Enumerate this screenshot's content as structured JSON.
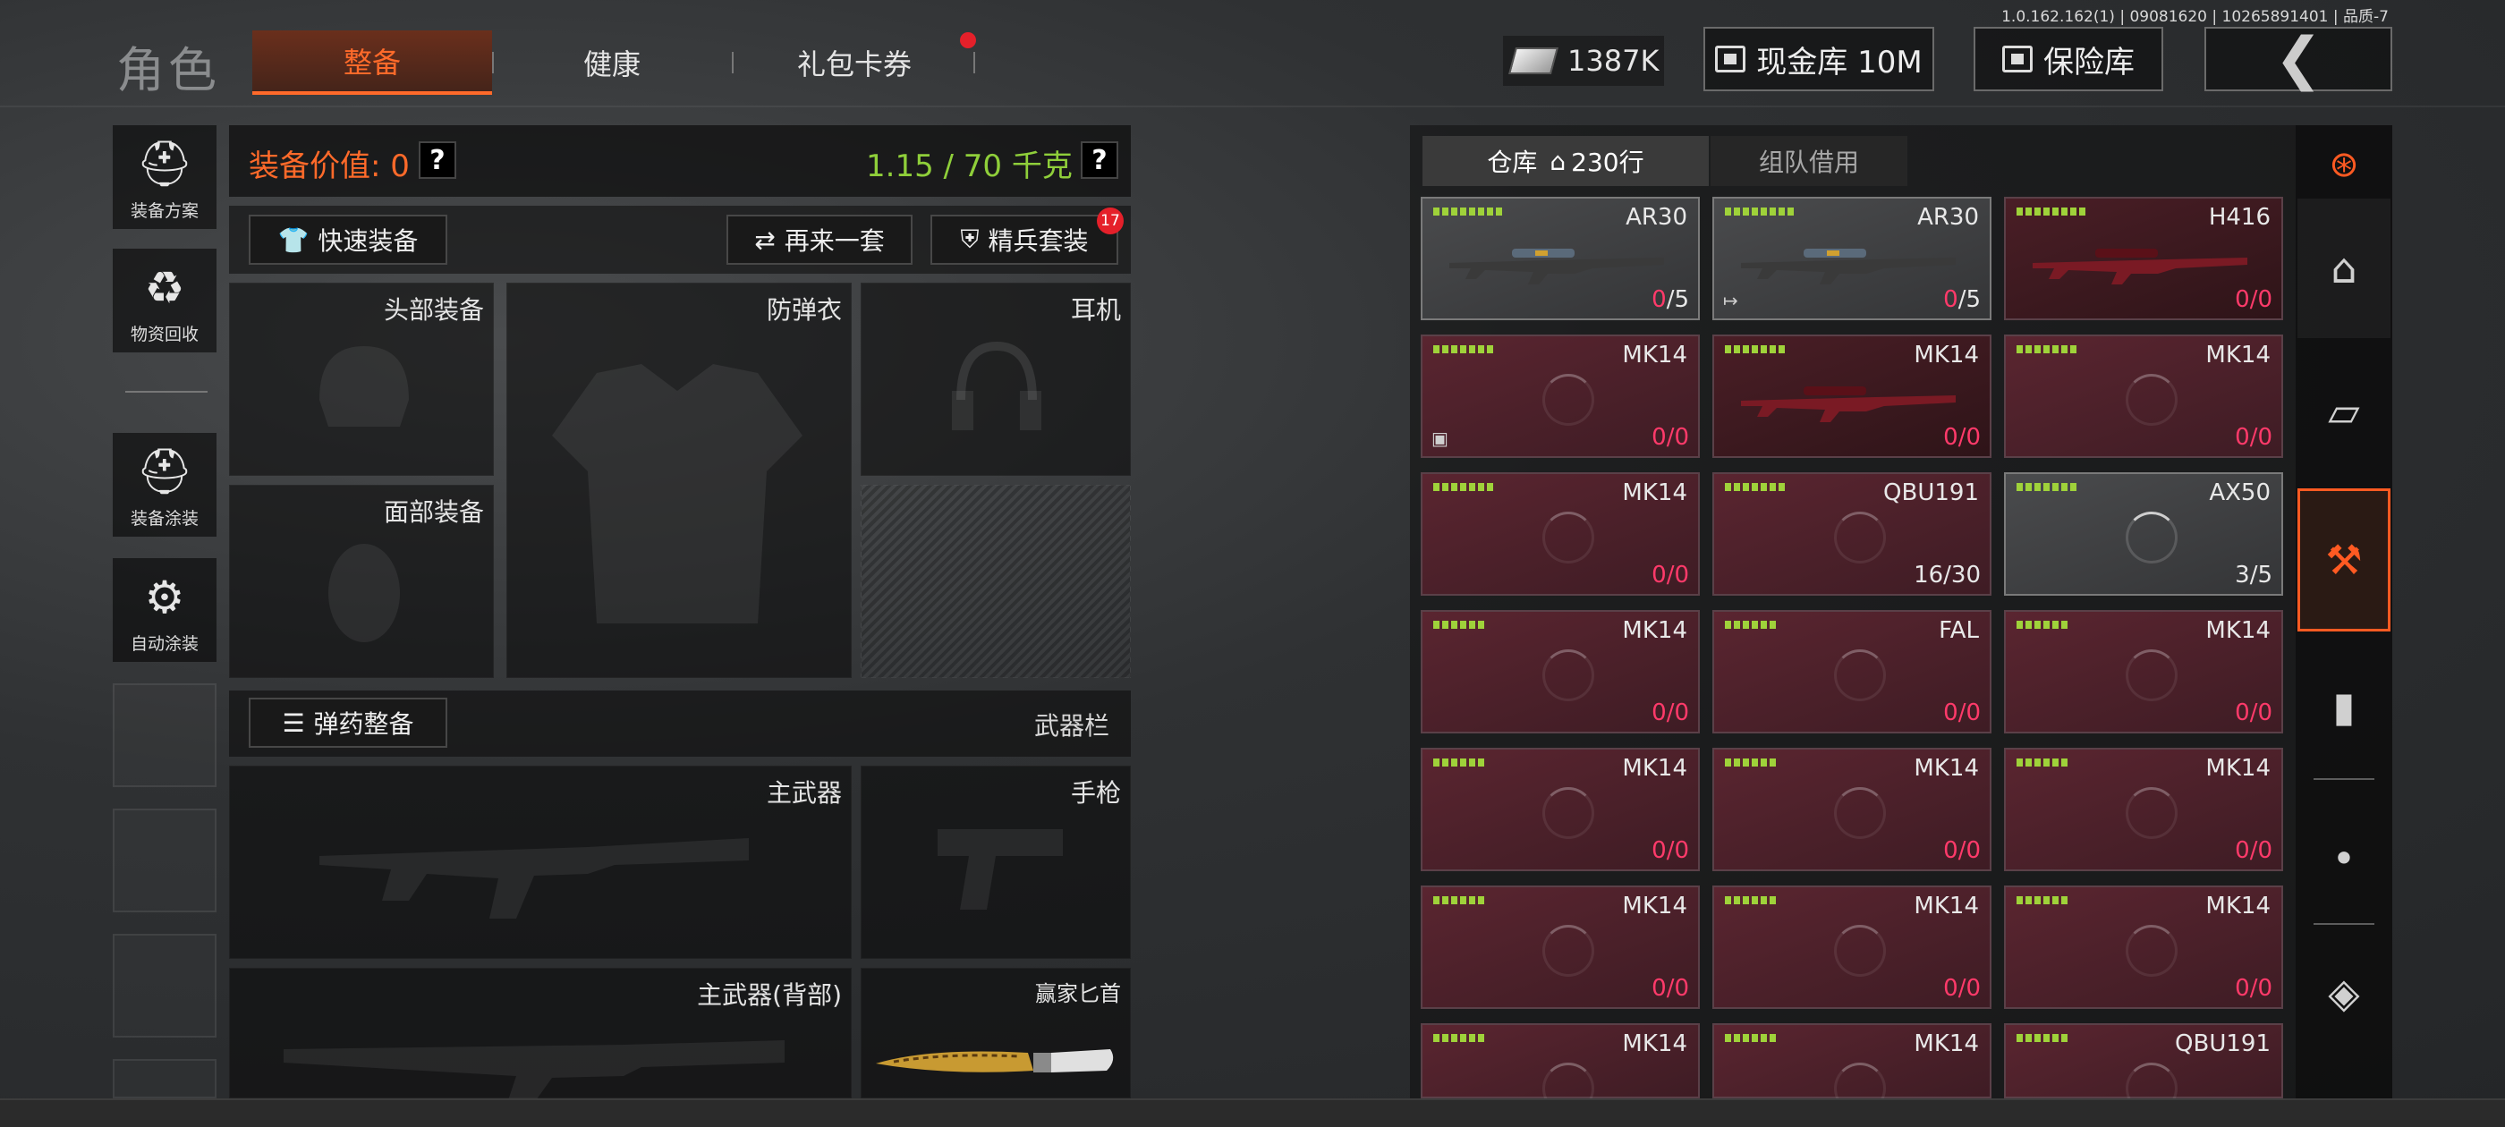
{
  "version": "1.0.162.162(1) | 09081620 | 10265891401 | 品质-7",
  "header": {
    "role_title": "角色",
    "tabs": [
      {
        "label": "整备",
        "active": true
      },
      {
        "label": "健康",
        "active": false
      },
      {
        "label": "礼包卡券",
        "active": false,
        "notification": true
      }
    ],
    "money": "1387K",
    "cash_vault": "现金库 10M",
    "safe": "保险库",
    "back_icon": "chevron-left-icon"
  },
  "side_menu": [
    {
      "label": "装备方案",
      "icon": "helmet-icon"
    },
    {
      "label": "物资回收",
      "icon": "recycle-icon"
    },
    {
      "label": "装备涂装",
      "icon": "paint-helmet-icon"
    },
    {
      "label": "自动涂装",
      "icon": "auto-paint-icon"
    }
  ],
  "equipment": {
    "value_label": "装备价值: 0",
    "weight": "1.15 / 70 千克",
    "help": "?",
    "quick_equip": "快速装备",
    "again_set": "再来一套",
    "elite_set": "精兵套装",
    "elite_badge": "17",
    "slots": {
      "head": "头部装备",
      "face": "面部装备",
      "armor": "防弹衣",
      "headset": "耳机",
      "primary": "主武器",
      "pistol": "手枪",
      "primary_back": "主武器(背部)",
      "knife": "赢家匕首"
    },
    "ammo_button": "弹药整备",
    "weapon_bar": "武器栏"
  },
  "warehouse": {
    "tab_storage": "仓库",
    "tab_rows": "230行",
    "tab_team": "组队借用",
    "colors": {
      "dots": "#9fd23a",
      "zero": "#ff3a6a",
      "accent": "#ff6a2a"
    },
    "items": [
      {
        "name": "AR30",
        "count_a": "0",
        "count_b": "/5",
        "style": "grey",
        "dots": 8,
        "image": "sniper-rifle"
      },
      {
        "name": "AR30",
        "count_a": "0",
        "count_b": "/5",
        "style": "grey",
        "dots": 8,
        "image": "sniper-rifle",
        "corner": "↦"
      },
      {
        "name": "H416",
        "count_a": "0",
        "count_b": "/0",
        "style": "darkred",
        "dots": 8,
        "image": "rifle-red"
      },
      {
        "name": "MK14",
        "count_a": "0",
        "count_b": "/0",
        "style": "red",
        "dots": 7,
        "corner": "▣"
      },
      {
        "name": "MK14",
        "count_a": "0",
        "count_b": "/0",
        "style": "darkred",
        "dots": 7,
        "image": "rifle-red"
      },
      {
        "name": "MK14",
        "count_a": "0",
        "count_b": "/0",
        "style": "red",
        "dots": 7
      },
      {
        "name": "MK14",
        "count_a": "0",
        "count_b": "/0",
        "style": "red",
        "dots": 7
      },
      {
        "name": "QBU191",
        "count_a": "16",
        "count_b": "/30",
        "style": "red",
        "dots": 7,
        "plain": true
      },
      {
        "name": "AX50",
        "count_a": "3",
        "count_b": "/5",
        "style": "grey",
        "dots": 7,
        "plain": true
      },
      {
        "name": "MK14",
        "count_a": "0",
        "count_b": "/0",
        "style": "red",
        "dots": 6
      },
      {
        "name": "FAL",
        "count_a": "0",
        "count_b": "/0",
        "style": "red",
        "dots": 6
      },
      {
        "name": "MK14",
        "count_a": "0",
        "count_b": "/0",
        "style": "red",
        "dots": 6
      },
      {
        "name": "MK14",
        "count_a": "0",
        "count_b": "/0",
        "style": "red",
        "dots": 6
      },
      {
        "name": "MK14",
        "count_a": "0",
        "count_b": "/0",
        "style": "red",
        "dots": 6
      },
      {
        "name": "MK14",
        "count_a": "0",
        "count_b": "/0",
        "style": "red",
        "dots": 6
      },
      {
        "name": "MK14",
        "count_a": "0",
        "count_b": "/0",
        "style": "red",
        "dots": 6
      },
      {
        "name": "MK14",
        "count_a": "0",
        "count_b": "/0",
        "style": "red",
        "dots": 6
      },
      {
        "name": "MK14",
        "count_a": "0",
        "count_b": "/0",
        "style": "red",
        "dots": 6
      },
      {
        "name": "MK14",
        "count_a": "",
        "count_b": "",
        "style": "red",
        "dots": 6
      },
      {
        "name": "MK14",
        "count_a": "",
        "count_b": "",
        "style": "red",
        "dots": 6
      },
      {
        "name": "QBU191",
        "count_a": "",
        "count_b": "",
        "style": "red",
        "dots": 6
      }
    ]
  },
  "categories": [
    {
      "icon": "layers-refresh-icon",
      "active": false
    },
    {
      "icon": "home-icon",
      "active": false
    },
    {
      "icon": "vest-icon",
      "active": false
    },
    {
      "icon": "rifle-icon",
      "active": true
    },
    {
      "icon": "magazine-icon",
      "active": false
    },
    {
      "icon": "bullet-icon",
      "active": false
    },
    {
      "icon": "attachment-icon",
      "active": false
    }
  ]
}
